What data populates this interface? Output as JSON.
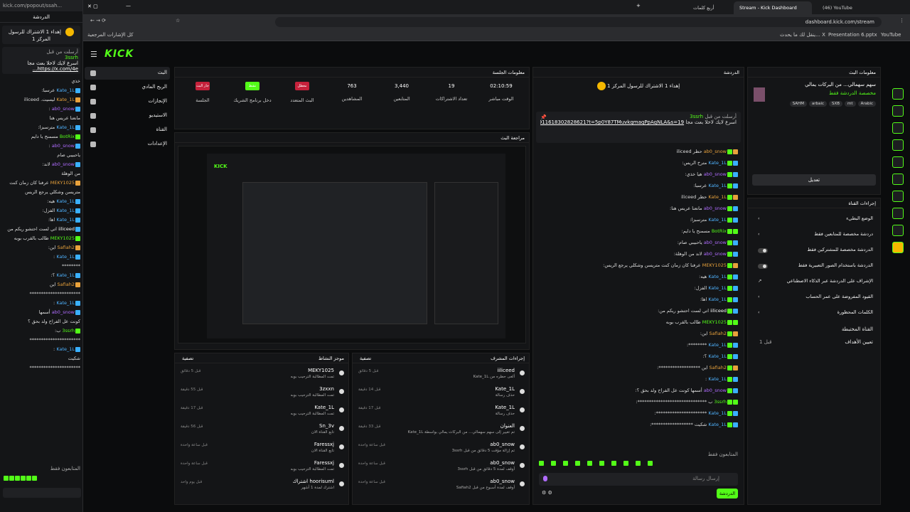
{
  "popout": {
    "url": "kick.com/popout/ssah...",
    "header": "الدردشة",
    "goal": "إهداء 1 الاشتراك للرسول المركز 1",
    "pinned_by": "أرسلت من قبل",
    "pinned_user": "3ssrh",
    "pinned_text": "اسرع لايك لاخلا بعث مجا",
    "pinned_link": "https://x.com/4e...",
    "messages": [
      {
        "u": "",
        "t": "خذي",
        "c": "w"
      },
      {
        "u": "Kate_1L",
        "t": "عرسبا:",
        "c": "b"
      },
      {
        "u": "Kate_1L",
        "t": "ليسيت. iliceed",
        "c": "o"
      },
      {
        "u": "ab0_snow",
        "t": ":",
        "c": "p"
      },
      {
        "u": "",
        "t": "مانعنا عريس هنا",
        "c": "w"
      },
      {
        "u": "Kate_1L",
        "t": "مترسبزا:",
        "c": "b"
      },
      {
        "u": "BotRix",
        "t": "مسمنح يا دايم",
        "c": "g"
      },
      {
        "u": "ab0_snow",
        "t": ":",
        "c": "p"
      },
      {
        "u": "",
        "t": "ياحبيبي صام",
        "c": "w"
      },
      {
        "u": "ab0_snow",
        "t": "لاند:",
        "c": "p"
      },
      {
        "u": "",
        "t": "من الوهلة",
        "c": "w"
      },
      {
        "u": "MEKY1025",
        "t": "عرفنا كان زمان كنت",
        "c": "o"
      },
      {
        "u": "",
        "t": "متريسن وشكلي يرجع الريس",
        "c": "w"
      },
      {
        "u": "Kate_1L",
        "t": "هيه:",
        "c": "b"
      },
      {
        "u": "Kate_1L",
        "t": "الفزل:",
        "c": "b"
      },
      {
        "u": "Kate_1L",
        "t": "اها:",
        "c": "b"
      },
      {
        "u": "iiliceed",
        "t": "اتي لست احتشو ريكم من",
        "c": "w"
      },
      {
        "u": "MEKY1025",
        "t": "طالب بالقرب بوبه",
        "c": "g"
      },
      {
        "u": "Safiah2",
        "t": "اين:",
        "c": "o"
      },
      {
        "u": "Kate_1L",
        "t": ":",
        "c": "b"
      },
      {
        "u": "",
        "t": "********",
        "c": "w"
      },
      {
        "u": "Kate_1L",
        "t": "؟:",
        "c": "b"
      },
      {
        "u": "Safiah2",
        "t": "اين",
        "c": "o"
      },
      {
        "u": "",
        "t": "**********************",
        "c": "w"
      },
      {
        "u": "Kate_1L",
        "t": ":",
        "c": "b"
      },
      {
        "u": "ab0_snow",
        "t": "أسمها",
        "c": "p"
      },
      {
        "u": "",
        "t": "كونت عل الفراح ولد بحق ؟",
        "c": "w"
      },
      {
        "u": "3ssrh",
        "t": "ب:",
        "c": "g"
      },
      {
        "u": "",
        "t": "**********************",
        "c": "w"
      },
      {
        "u": "Kate_1L",
        "t": ":",
        "c": "b"
      },
      {
        "u": "",
        "t": "شكيت",
        "c": "w"
      },
      {
        "u": "",
        "t": "**********************",
        "c": "w"
      }
    ],
    "subs_only": "المتابعون فقط"
  },
  "tabs": [
    {
      "label": "أربع كلمات",
      "active": false
    },
    {
      "label": "Stream - Kick Dashboard",
      "active": true
    },
    {
      "label": "(46) YouTube",
      "active": false
    }
  ],
  "address": "dashboard.kick.com/stream",
  "bookmarks": {
    "all": "كل الإشارات المرجعية",
    "b1": "ينقل لك ما يحدث... X",
    "b2": "Presentation 6.pptx",
    "b3": "YouTube"
  },
  "logo": "KICK",
  "nav": [
    {
      "label": "البث",
      "icon": "broadcast-icon",
      "active": true
    },
    {
      "label": "الربح المادي",
      "icon": "money-icon"
    },
    {
      "label": "الإنجازات",
      "icon": "trophy-icon"
    },
    {
      "label": "الاستيديو",
      "icon": "studio-icon"
    },
    {
      "label": "القناة",
      "icon": "channel-icon"
    },
    {
      "label": "الإعدادات",
      "icon": "settings-icon"
    }
  ],
  "session": {
    "title": "معلومات الجلسة",
    "stats": [
      {
        "value": "02:10:59",
        "label": "الوقت مباشر"
      },
      {
        "value": "19",
        "label": "تعداد الاشتراكات"
      },
      {
        "value": "3,440",
        "label": "المتابعين"
      },
      {
        "value": "763",
        "label": "المشاهدين"
      },
      {
        "value": "معطل",
        "label": "البث المتعدد",
        "box": "#c6213b"
      },
      {
        "value": "نشط",
        "label": "دخل برنامج الشريك",
        "box": "#53fc18"
      },
      {
        "value": "جار البث",
        "label": "الجلسة",
        "box": "#c6213b"
      }
    ]
  },
  "preview_title": "مراجعة البث",
  "activity": {
    "title": "موجز النشاط",
    "filter": "تصفية",
    "rows": [
      {
        "name": "MEKY1025",
        "sub": "تمت المطالبة الترحيب بوبه",
        "time": "قبل 5 دقائق"
      },
      {
        "name": "3zxxn",
        "sub": "تمت المطالبة الترحيب بوبه",
        "time": "قبل 55 دقيقة"
      },
      {
        "name": "Kate_1L",
        "sub": "تمت المطالبة الترحيب بوبه",
        "time": "قبل 17 دقيقة"
      },
      {
        "name": "Sn_3v",
        "sub": "تابع القناة الان",
        "time": "قبل 56 دقيقة"
      },
      {
        "name": "Faressxj",
        "sub": "تابع القناة الان",
        "time": "قبل ساعة واحدة"
      },
      {
        "name": "Faressxj",
        "sub": "تمت المطالبة الترحيب بوبه",
        "time": "قبل ساعة واحدة"
      },
      {
        "name": "hoorisuml اشتراك",
        "sub": "اشترك لمدة 1 أشهر",
        "time": "قبل يوم واحد"
      }
    ]
  },
  "modactions": {
    "title": "إجراءات المشرف",
    "filter": "تصفية",
    "rows": [
      {
        "name": "iiliceed",
        "sub": "ألغى حظره من Kate_1L",
        "time": "قبل 5 دقائق"
      },
      {
        "name": "Kate_1L",
        "sub": "حذف رسالة",
        "time": "قبل 14 دقيقة"
      },
      {
        "name": "Kate_1L",
        "sub": "حذف رسالة",
        "time": "قبل 17 دقيقة"
      },
      {
        "name": "العنوان",
        "sub": "تم تغيير إلى سهم سهمالي... من البركات يمالي بواسطة Kate_1L",
        "time": "قبل 33 دقيقة"
      },
      {
        "name": "ab0_snow",
        "sub": "تم إزالة مؤقت 5 دقائق من قبل 3ssrh",
        "time": "قبل ساعة واحدة"
      },
      {
        "name": "ab0_snow",
        "sub": "أوقف لمدة 5 دقائق من قبل 3ssrh",
        "time": "قبل ساعة واحدة"
      },
      {
        "name": "ab0_snow",
        "sub": "أوقف لمدة أسبوع من قبل Safiah2",
        "time": "قبل ساعة واحدة"
      }
    ]
  },
  "chat": {
    "title": "الدردشة",
    "goal": "إهداء 1 الاشتراك للرسول المركز 1",
    "pinned_by": "أرسلت من قبل",
    "pinned_user": "3ssrh",
    "pinned_text": "اسرع لايك لاخلا بعث مجا",
    "pinned_link": "https://x.com/4e56/status/1969911618302828621?t=5p0Y87TMuvkqmaqPpAqNLA&s=19",
    "messages": [
      {
        "u": "ab0_snow",
        "t": "حظر iliceed",
        "c": "o"
      },
      {
        "u": "Kate_1L",
        "t": "مترخ الريس:",
        "c": "b"
      },
      {
        "u": "ab0_snow",
        "t": "هيا خذي:",
        "c": "p"
      },
      {
        "u": "Kate_1L",
        "t": "عرسبا:",
        "c": "b"
      },
      {
        "u": "Kate_1L",
        "t": "حظر iliceed",
        "c": "o"
      },
      {
        "u": "ab0_snow",
        "t": "مانعنا عريس هنا:",
        "c": "p"
      },
      {
        "u": "Kate_1L",
        "t": "مترسبزا:",
        "c": "b"
      },
      {
        "u": "BotRix",
        "t": "مسمنح يا دايم:",
        "c": "g"
      },
      {
        "u": "ab0_snow",
        "t": "ياحبيبي صام:",
        "c": "p"
      },
      {
        "u": "ab0_snow",
        "t": "لاند من الوهلة:",
        "c": "p"
      },
      {
        "u": "MEKY1025",
        "t": "عرفنا كان زمان كنت متريسن وشكلي يرجع الريس:",
        "c": "o"
      },
      {
        "u": "Kate_1L",
        "t": "هيه:",
        "c": "b"
      },
      {
        "u": "Kate_1L",
        "t": "الفزل:",
        "c": "b"
      },
      {
        "u": "Kate_1L",
        "t": "اها:",
        "c": "b"
      },
      {
        "u": "iiliceed",
        "t": "اتي لست احتشو ريكم من:",
        "c": "w"
      },
      {
        "u": "MEKY1025",
        "t": "طالب بالقرب بوبه",
        "c": "g"
      },
      {
        "u": "Safiah2",
        "t": "اين:",
        "c": "o"
      },
      {
        "u": "Kate_1L",
        "t": "********:",
        "c": "b"
      },
      {
        "u": "Kate_1L",
        "t": "؟:",
        "c": "b"
      },
      {
        "u": "Safiah2",
        "t": "اين ******************:",
        "c": "o"
      },
      {
        "u": "Kate_1L",
        "t": ":",
        "c": "b"
      },
      {
        "u": "ab0_snow",
        "t": "أسمها كونت عل الفراح ولد بحق ؟:",
        "c": "p"
      },
      {
        "u": "3ssrh",
        "t": "ب ******************************:",
        "c": "g"
      },
      {
        "u": "Kate_1L",
        "t": "**********************:",
        "c": "b"
      },
      {
        "u": "Kate_1L",
        "t": "شكيت ******************:",
        "c": "b"
      }
    ],
    "followers_only": "المتابعون فقط",
    "input_placeholder": "إرسال رسالة",
    "send": "الدردشة"
  },
  "streaminfo": {
    "title": "معلومات البث",
    "stream_title": "سهم سهمالي... من البركات يمالي",
    "category": "مخصصة الدردشة فقط",
    "tags": [
      "Arabic",
      "mt",
      "SXB",
      "arbaic",
      "SAHM"
    ],
    "edit": "تعديل"
  },
  "channel_actions": {
    "title": "إجراءات القناة",
    "options": [
      {
        "label": "الوضع البطيء",
        "ctl": "arrow"
      },
      {
        "label": "دردشة مخصصة للمتابعين فقط",
        "ctl": "arrow"
      },
      {
        "label": "الدردشة مخصصة للمشتركين فقط",
        "ctl": "toggle"
      },
      {
        "label": "الدردشة باستخدام الصور التعبيرية فقط",
        "ctl": "toggle"
      },
      {
        "label": "الإشراف على الدردشة عبر الذكاء الاصطناعي",
        "ctl": "link"
      },
      {
        "label": "القيود المفروضة على عمر الحساب",
        "ctl": "arrow"
      },
      {
        "label": "الكلمات المحظورة",
        "ctl": "arrow"
      }
    ],
    "target_title": "القناة المختبطة",
    "target_label": "تعيين الأهداف",
    "target_value": "قبل 1"
  }
}
